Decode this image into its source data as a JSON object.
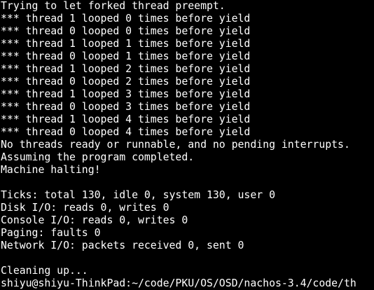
{
  "terminal": {
    "lines": [
      "Trying to let forked thread preempt.",
      "*** thread 1 looped 0 times before yield",
      "*** thread 0 looped 0 times before yield",
      "*** thread 1 looped 1 times before yield",
      "*** thread 0 looped 1 times before yield",
      "*** thread 1 looped 2 times before yield",
      "*** thread 0 looped 2 times before yield",
      "*** thread 1 looped 3 times before yield",
      "*** thread 0 looped 3 times before yield",
      "*** thread 1 looped 4 times before yield",
      "*** thread 0 looped 4 times before yield",
      "No threads ready or runnable, and no pending interrupts.",
      "Assuming the program completed.",
      "Machine halting!",
      "",
      "Ticks: total 130, idle 0, system 130, user 0",
      "Disk I/O: reads 0, writes 0",
      "Console I/O: reads 0, writes 0",
      "Paging: faults 0",
      "Network I/O: packets received 0, sent 0",
      "",
      "Cleaning up...",
      "shiyu@shiyu-ThinkPad:~/code/PKU/OS/OSD/nachos-3.4/code/th"
    ]
  }
}
